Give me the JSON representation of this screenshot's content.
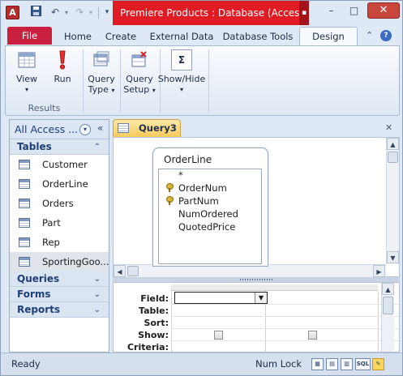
{
  "window": {
    "title": "Premiere Products : Database (Access...",
    "app_icon": "A",
    "qat": {
      "save_icon": "save-icon",
      "undo_icon": "undo-icon",
      "redo_icon": "redo-icon",
      "customize_icon": "customize-qat-icon"
    },
    "controls": {
      "minimize": "–",
      "maximize": "□",
      "close": "✕"
    }
  },
  "tabs": {
    "file": "File",
    "home": "Home",
    "create": "Create",
    "external_data": "External Data",
    "database_tools": "Database Tools",
    "design": "Design"
  },
  "ribbon": {
    "view": "View",
    "run": "Run",
    "query_type": [
      "Query",
      "Type"
    ],
    "query_setup": [
      "Query",
      "Setup"
    ],
    "show_hide": "Show/Hide",
    "results_group": "Results"
  },
  "nav": {
    "title": "All Access ...",
    "groups": {
      "tables": "Tables",
      "queries": "Queries",
      "forms": "Forms",
      "reports": "Reports"
    },
    "tables": [
      "Customer",
      "OrderLine",
      "Orders",
      "Part",
      "Rep",
      "SportingGoo..."
    ]
  },
  "document": {
    "tab": "Query3",
    "field_list": {
      "title": "OrderLine",
      "fields": [
        "*",
        "OrderNum",
        "PartNum",
        "NumOrdered",
        "QuotedPrice"
      ]
    },
    "grid": {
      "rows": [
        "Field:",
        "Table:",
        "Sort:",
        "Show:",
        "Criteria:"
      ],
      "show_checked": [
        false,
        false
      ]
    }
  },
  "status": {
    "left": "Ready",
    "num_lock": "Num Lock",
    "sql": "SQL"
  },
  "colors": {
    "title_red": "#e01b24",
    "file_tab": "#c8203e",
    "doc_tab": "#f7c95c"
  }
}
